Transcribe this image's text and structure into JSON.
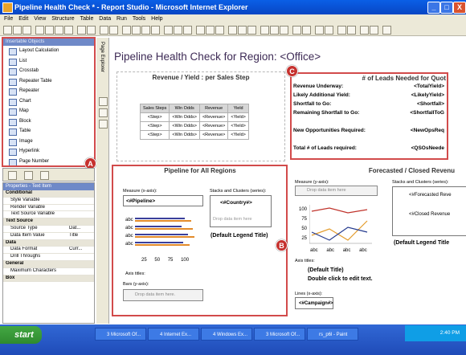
{
  "window": {
    "title": "Pipeline Health Check * - Report Studio - Microsoft Internet Explorer",
    "min": "_",
    "max": "□",
    "close": "X"
  },
  "menu": [
    "File",
    "Edit",
    "View",
    "Structure",
    "Table",
    "Data",
    "Run",
    "Tools",
    "Help"
  ],
  "explorer_label": "Page Explorer",
  "insertable": {
    "header": "Insertable Objects",
    "items": [
      "Layout Calculation",
      "List",
      "Crosstab",
      "Repeater Table",
      "Repeater",
      "Chart",
      "Map",
      "Block",
      "Table",
      "Image",
      "Hyperlink",
      "Page Number"
    ]
  },
  "properties": {
    "header": "Properties - Text Item",
    "rows": [
      {
        "type": "group",
        "label": "Conditional"
      },
      {
        "type": "item",
        "label": "Style Variable",
        "value": ""
      },
      {
        "type": "item",
        "label": "Render Variable",
        "value": ""
      },
      {
        "type": "item",
        "label": "Text Source Variable",
        "value": ""
      },
      {
        "type": "group",
        "label": "Text Source"
      },
      {
        "type": "item",
        "label": "Source Type",
        "value": "Dat..."
      },
      {
        "type": "item",
        "label": "Data Item Value",
        "value": "Title"
      },
      {
        "type": "group",
        "label": "Data"
      },
      {
        "type": "item",
        "label": "Data Format",
        "value": "Curr..."
      },
      {
        "type": "item",
        "label": "Drill Throughs",
        "value": ""
      },
      {
        "type": "group",
        "label": "General"
      },
      {
        "type": "item",
        "label": "Maximum Characters",
        "value": ""
      },
      {
        "type": "group",
        "label": "Box"
      }
    ]
  },
  "report": {
    "title": "Pipeline Health Check for Region:  <Office>",
    "revenue_title": "Revenue / Yield : per Sales Step",
    "table_headers": [
      "Sales Steps",
      "Win Odds",
      "Revenue",
      "Yield"
    ],
    "table_rows": [
      [
        "<Step>",
        "<Win Odds>",
        "<Revenue>",
        "<Yield>"
      ],
      [
        "<Step>",
        "<Win Odds>",
        "<Revenue>",
        "<Yield>"
      ],
      [
        "<Step>",
        "<Win Odds>",
        "<Revenue>",
        "<Yield>"
      ]
    ],
    "leads_title": "# of Leads Needed for Quot",
    "leads_rows": [
      {
        "label": "Revenue Underway:",
        "value": "<TotalYield>"
      },
      {
        "label": "Likely Additional Yield:",
        "value": "<LikelyYield>"
      },
      {
        "label": "Shortfall to Go:",
        "value": "<Shortfall>"
      },
      {
        "label": "Remaining Shortfall to Go:",
        "value": "<ShortfallToG"
      },
      {
        "label": "",
        "value": ""
      },
      {
        "label": "New Opportunities Required:",
        "value": "<NewOpsReq"
      },
      {
        "label": "",
        "value": ""
      },
      {
        "label": "Total # of Leads required:",
        "value": "<QSOsNeede"
      }
    ],
    "pipeline": {
      "title": "Pipeline for All Regions",
      "measure_label": "Measure (x-axis):",
      "measure_value": "<#Pipeline>",
      "stacks_label": "Stacks and Clusters (series):",
      "country_value": "<#Country#>",
      "drop_text": "Drop data item here",
      "legend_text": "(Default Legend Title)",
      "axis_titles": "Axis titles:",
      "bars_label": "Bars (y-axis):",
      "drop_here": "Drop data item here.",
      "categories": [
        "abc",
        "abc",
        "abc",
        "abc"
      ],
      "ticks": [
        "25",
        "50",
        "75",
        "100"
      ]
    },
    "forecast": {
      "title": "Forecasted / Closed Revenu",
      "measure_label": "Measure (y-axis):",
      "drop_text": "Drop data item here",
      "stacks_label": "Stacks and Clusters (series):",
      "series1": "<#Forecasted Reve",
      "series2": "<#Closed Revenue",
      "legend_text": "(Default Legend Title",
      "yticks": [
        "100",
        "75",
        "50",
        "25"
      ],
      "xticks": [
        "abc",
        "abc",
        "abc",
        "abc"
      ],
      "axis_titles": "Axis titles:",
      "default_title": "(Default Title)",
      "dbl_click": "Double click to edit text.",
      "lines_label": "Lines (x-axis):",
      "campaign": "<#Campaign#>"
    }
  },
  "callouts": [
    "A",
    "B",
    "C"
  ],
  "taskbar": {
    "start": "start",
    "tasks": [
      "3 Microsoft Of...",
      "4 Internet Ex...",
      "4 Windows Ex...",
      "3 Microsoft Of...",
      "rs_p6l - Paint"
    ],
    "time": "2:40 PM"
  }
}
